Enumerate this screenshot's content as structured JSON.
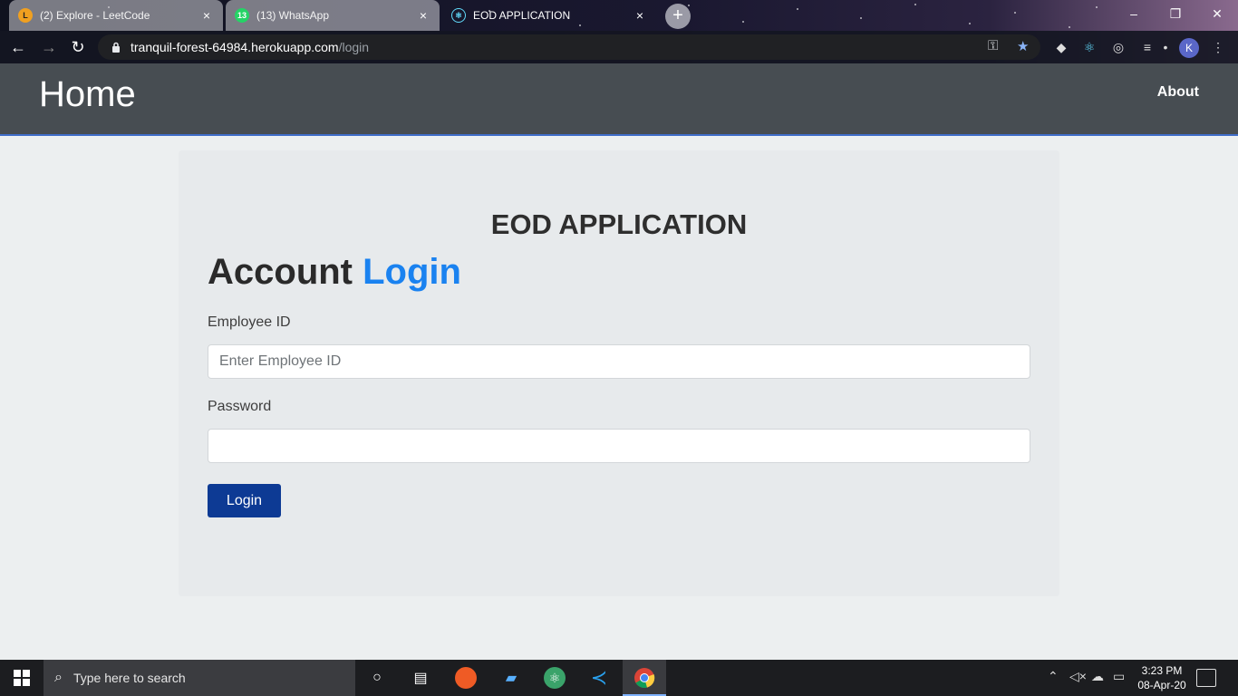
{
  "browser": {
    "tabs": [
      {
        "title": "(2) Explore - LeetCode",
        "active": false
      },
      {
        "title": "(13) WhatsApp",
        "active": false
      },
      {
        "title": "EOD APPLICATION",
        "active": true
      }
    ],
    "url_host": "tranquil-forest-64984.herokuapp.com",
    "url_path": "/login",
    "profile_initial": "K",
    "newtab_symbol": "+",
    "tab_close_symbol": "×"
  },
  "navbar": {
    "brand": "Home",
    "links": [
      "About"
    ]
  },
  "login": {
    "app_title": "EOD APPLICATION",
    "heading_prefix": "Account",
    "heading_accent": "Login",
    "employee_id_label": "Employee ID",
    "employee_id_placeholder": "Enter Employee ID",
    "employee_id_value": "",
    "password_label": "Password",
    "password_value": "",
    "submit_label": "Login"
  },
  "taskbar": {
    "search_placeholder": "Type here to search",
    "time": "3:23 PM",
    "date": "08-Apr-20"
  },
  "colors": {
    "navbar_bg": "#474d52",
    "accent_blue": "#1a82f0",
    "button_bg": "#0d3a94",
    "card_bg": "#e7eaec"
  }
}
